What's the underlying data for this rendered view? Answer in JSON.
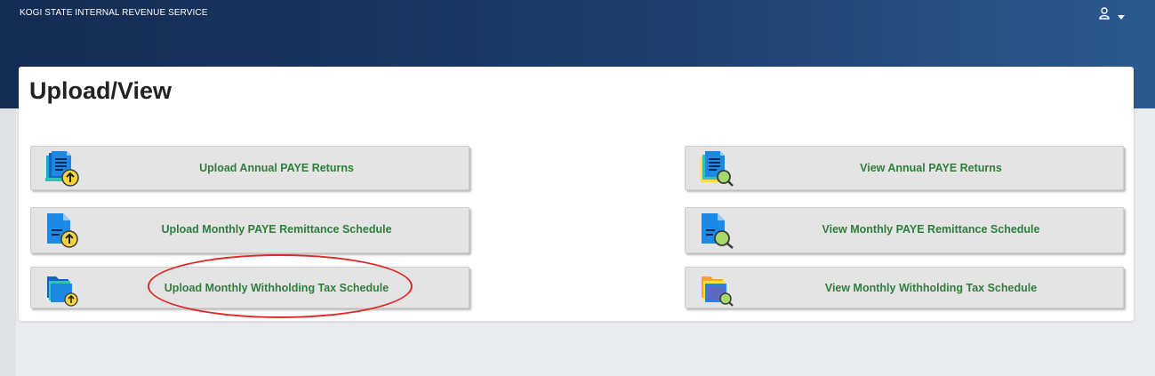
{
  "header": {
    "org_name": "KOGI STATE INTERNAL REVENUE SERVICE",
    "user_icon": "user-icon",
    "dropdown_icon": "caret-down-icon",
    "background_color": "#1d3d6b"
  },
  "page": {
    "title": "Upload/View"
  },
  "actions": {
    "upload": [
      {
        "label": "Upload Annual PAYE Returns",
        "icon": "document-upload-icon"
      },
      {
        "label": "Upload Monthly PAYE Remittance Schedule",
        "icon": "file-upload-icon"
      },
      {
        "label": "Upload Monthly Withholding Tax Schedule",
        "icon": "folder-upload-icon"
      }
    ],
    "view": [
      {
        "label": "View Annual PAYE Returns",
        "icon": "document-search-icon"
      },
      {
        "label": "View Monthly PAYE Remittance Schedule",
        "icon": "file-search-icon"
      },
      {
        "label": "View Monthly Withholding Tax Schedule",
        "icon": "folder-search-icon"
      }
    ]
  },
  "colors": {
    "label_green": "#2f7e3c",
    "highlight_red": "#e02828",
    "upload_badge": "#f5d33b",
    "view_badge": "#a6d86d",
    "doc_blue": "#1e88e5"
  }
}
